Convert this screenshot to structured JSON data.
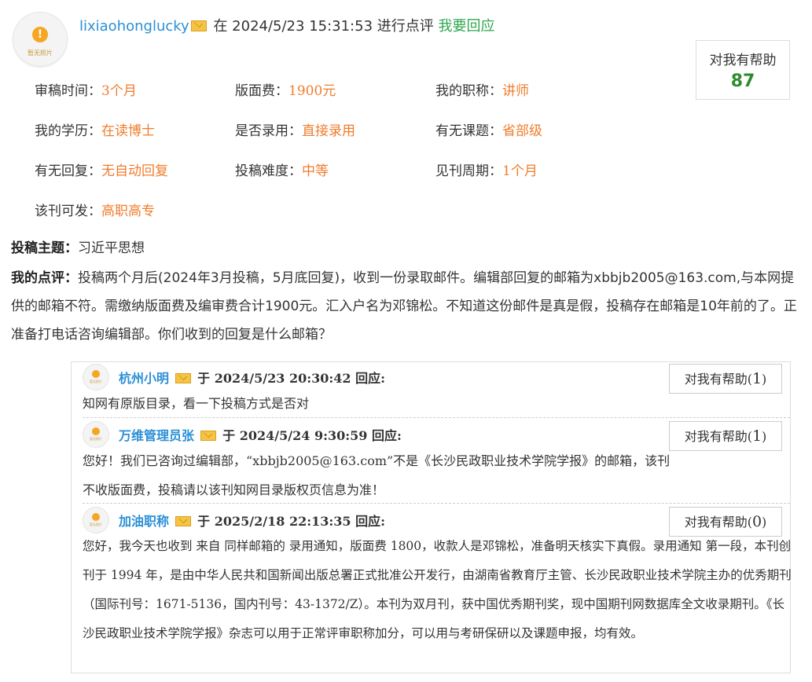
{
  "review": {
    "username": "lixiaohonglucky",
    "date_prefix": "在",
    "datetime": "2024/5/23 15:31:53",
    "action": "进行点评",
    "reply_link": "我要回应",
    "avatar_caption": "暂无照片",
    "helpful_label": "对我有帮助",
    "helpful_count": "87",
    "fields": [
      {
        "label": "审稿时间：",
        "value": "3个月"
      },
      {
        "label": "版面费：",
        "value": "1900元"
      },
      {
        "label": "我的职称：",
        "value": "讲师"
      },
      {
        "label": "我的学历：",
        "value": "在读博士"
      },
      {
        "label": "是否录用：",
        "value": "直接录用"
      },
      {
        "label": "有无课题：",
        "value": "省部级"
      },
      {
        "label": "有无回复：",
        "value": "无自动回复"
      },
      {
        "label": "投稿难度：",
        "value": "中等"
      },
      {
        "label": "见刊周期：",
        "value": "1个月"
      },
      {
        "label": "该刊可发：",
        "value": "高职高专"
      }
    ],
    "topic_label": "投稿主题：",
    "topic_value": "习近平思想",
    "comment_label": "我的点评：",
    "comment_text": "投稿两个月后(2024年3月投稿，5月底回复)，收到一份录取邮件。编辑部回复的邮箱为xbbjb2005@163.com,与本网提供的邮箱不符。需缴纳版面费及编审费合计1900元。汇入户名为邓锦松。不知道这份邮件是真是假，投稿存在邮箱是10年前的了。正准备打电话咨询编辑部。你们收到的回复是什么邮箱？"
  },
  "replies": [
    {
      "name": "杭州小明",
      "prefix": "于",
      "datetime": "2024/5/23 20:30:42",
      "suffix": "回应:",
      "helpful_label": "对我有帮助",
      "helpful_count": "1",
      "body": "知网有原版目录，看一下投稿方式是否对"
    },
    {
      "name": "万维管理员张",
      "prefix": "于",
      "datetime": "2024/5/24 9:30:59",
      "suffix": "回应:",
      "helpful_label": "对我有帮助",
      "helpful_count": "1",
      "body": "您好！我们已咨询过编辑部，“xbbjb2005@163.com”不是《长沙民政职业技术学院学报》的邮箱，该刊不收版面费，投稿请以该刊知网目录版权页信息为准！"
    },
    {
      "name": "加油职称",
      "prefix": "于",
      "datetime": "2025/2/18 22:13:35",
      "suffix": "回应:",
      "helpful_label": "对我有帮助",
      "helpful_count": "0",
      "body": "您好，我今天也收到 来自 同样邮箱的 录用通知，版面费 1800，收款人是邓锦松，准备明天核实下真假。录用通知 第一段，本刊创刊于 1994 年，是由中华人民共和国新闻出版总署正式批准公开发行，由湖南省教育厅主管、长沙民政职业技术学院主办的优秀期刊（国际刊号：1671-5136，国内刊号：43-1372/Z）。本刊为双月刊，获中国优秀期刊奖，现中国期刊网数据库全文收录期刊。《长沙民政职业技术学院学报》杂志可以用于正常评审职称加分，可以用与考研保研以及课题申报，均有效。"
    }
  ]
}
